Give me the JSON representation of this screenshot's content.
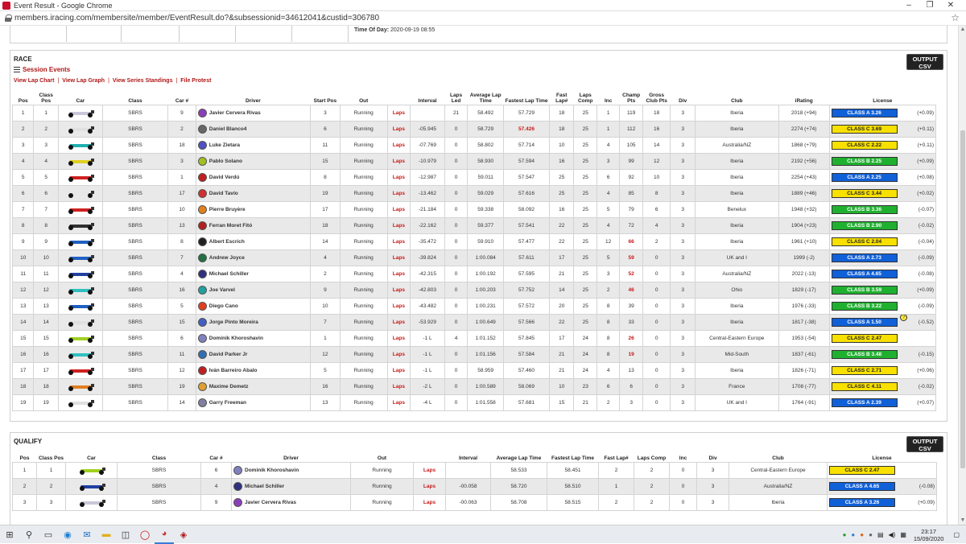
{
  "window": {
    "title": "Event Result - Google Chrome",
    "url": "members.iracing.com/membersite/member/EventResult.do?&subsessionid=34612041&custid=306780"
  },
  "top_panel": {
    "time_of_day_label": "Time Of Day:",
    "time_of_day_value": "2020-09-19 08:55"
  },
  "race": {
    "section_title": "RACE",
    "csv_button": [
      "OUTPUT",
      "CSV"
    ],
    "session_events": "Session Events",
    "links": [
      "View Lap Chart",
      "View Lap Graph",
      "View Series Standings",
      "File Protest"
    ],
    "headers": [
      "Pos",
      "Class Pos",
      "Car",
      "Class",
      "Car #",
      "Driver",
      "Start Pos",
      "Out",
      "",
      "Interval",
      "Laps Led",
      "Average Lap Time",
      "Fastest Lap Time",
      "Fast Lap#",
      "Laps Comp",
      "Inc",
      "Champ Pts",
      "Gross Club Pts",
      "Div",
      "Club",
      "iRating",
      "License"
    ],
    "rows": [
      {
        "pos": "1",
        "cpos": "1",
        "cls": "SBRS",
        "num": "9",
        "driver": "Javier Cervera Rivas",
        "start": "3",
        "out": "Running",
        "laps": "Laps",
        "interval": "",
        "led": "21",
        "avg": "58.492",
        "fast": "57.729",
        "flap": "18",
        "comp": "25",
        "inc": "1",
        "champ": "119",
        "gross": "18",
        "div": "3",
        "club": "Iberia",
        "ir": "2018 (+94)",
        "lic": "CLASS A 3.26",
        "lc": "A",
        "chg": "(+0.09)",
        "car": "#c8c8d8",
        "helm": "#8a3fb8",
        "champ_red": false,
        "fast_red": false
      },
      {
        "pos": "2",
        "cpos": "2",
        "cls": "SBRS",
        "num": "2",
        "driver": "Daniel Blanco4",
        "start": "6",
        "out": "Running",
        "laps": "Laps",
        "interval": "-05.945",
        "led": "0",
        "avg": "58.729",
        "fast": "57.426",
        "flap": "18",
        "comp": "25",
        "inc": "1",
        "champ": "112",
        "gross": "16",
        "div": "3",
        "club": "Iberia",
        "ir": "2274 (+74)",
        "lic": "CLASS C 3.69",
        "lc": "C",
        "chg": "(+0.11)",
        "car": "#e0e0e0",
        "helm": "#666666",
        "champ_red": false,
        "fast_red": true
      },
      {
        "pos": "3",
        "cpos": "3",
        "cls": "SBRS",
        "num": "18",
        "driver": "Luke Zietara",
        "start": "11",
        "out": "Running",
        "laps": "Laps",
        "interval": "-07.769",
        "led": "0",
        "avg": "58.802",
        "fast": "57.714",
        "flap": "10",
        "comp": "25",
        "inc": "4",
        "champ": "105",
        "gross": "14",
        "div": "3",
        "club": "Australia/NZ",
        "ir": "1868 (+79)",
        "lic": "CLASS C 2.22",
        "lc": "C",
        "chg": "(+0.11)",
        "car": "#20b0b0",
        "helm": "#5050c0",
        "champ_red": false,
        "fast_red": false
      },
      {
        "pos": "4",
        "cpos": "4",
        "cls": "SBRS",
        "num": "3",
        "driver": "Pablo Solano",
        "start": "15",
        "out": "Running",
        "laps": "Laps",
        "interval": "-10.979",
        "led": "0",
        "avg": "58.930",
        "fast": "57.594",
        "flap": "16",
        "comp": "25",
        "inc": "3",
        "champ": "99",
        "gross": "12",
        "div": "3",
        "club": "Iberia",
        "ir": "2192 (+56)",
        "lic": "CLASS B 2.25",
        "lc": "B",
        "chg": "(+0.09)",
        "car": "#e0d020",
        "helm": "#a0c020",
        "champ_red": false,
        "fast_red": false
      },
      {
        "pos": "5",
        "cpos": "5",
        "cls": "SBRS",
        "num": "1",
        "driver": "David Verdú",
        "start": "8",
        "out": "Running",
        "laps": "Laps",
        "interval": "-12.987",
        "led": "0",
        "avg": "59.011",
        "fast": "57.547",
        "flap": "25",
        "comp": "25",
        "inc": "6",
        "champ": "92",
        "gross": "10",
        "div": "3",
        "club": "Iberia",
        "ir": "2254 (+43)",
        "lic": "CLASS A 2.25",
        "lc": "A",
        "chg": "(+0.08)",
        "car": "#d02020",
        "helm": "#c02020",
        "champ_red": false,
        "fast_red": false
      },
      {
        "pos": "6",
        "cpos": "6",
        "cls": "SBRS",
        "num": "17",
        "driver": "David Tavío",
        "start": "19",
        "out": "Running",
        "laps": "Laps",
        "interval": "-13.462",
        "led": "0",
        "avg": "59.029",
        "fast": "57.616",
        "flap": "25",
        "comp": "25",
        "inc": "4",
        "champ": "85",
        "gross": "8",
        "div": "3",
        "club": "Iberia",
        "ir": "1889 (+46)",
        "lic": "CLASS C 3.44",
        "lc": "C",
        "chg": "(+0.02)",
        "car": "#e8e8e8",
        "helm": "#d03030",
        "champ_red": false,
        "fast_red": false
      },
      {
        "pos": "7",
        "cpos": "7",
        "cls": "SBRS",
        "num": "10",
        "driver": "Pierre Bruyère",
        "start": "17",
        "out": "Running",
        "laps": "Laps",
        "interval": "-21.184",
        "led": "0",
        "avg": "59.338",
        "fast": "58.092",
        "flap": "16",
        "comp": "25",
        "inc": "5",
        "champ": "79",
        "gross": "6",
        "div": "3",
        "club": "Benelux",
        "ir": "1948 (+32)",
        "lic": "CLASS B 3.36",
        "lc": "B",
        "chg": "(-0.07)",
        "car": "#d02020",
        "helm": "#e08020",
        "champ_red": false,
        "fast_red": false
      },
      {
        "pos": "8",
        "cpos": "8",
        "cls": "SBRS",
        "num": "13",
        "driver": "Ferran Moret Fitó",
        "start": "18",
        "out": "Running",
        "laps": "Laps",
        "interval": "-22.162",
        "led": "0",
        "avg": "59.377",
        "fast": "57.541",
        "flap": "22",
        "comp": "25",
        "inc": "4",
        "champ": "72",
        "gross": "4",
        "div": "3",
        "club": "Iberia",
        "ir": "1904 (+23)",
        "lic": "CLASS B 2.90",
        "lc": "B",
        "chg": "(-0.02)",
        "car": "#303030",
        "helm": "#b02020",
        "champ_red": false,
        "fast_red": false
      },
      {
        "pos": "9",
        "cpos": "9",
        "cls": "SBRS",
        "num": "8",
        "driver": "Albert Escrich",
        "start": "14",
        "out": "Running",
        "laps": "Laps",
        "interval": "-35.472",
        "led": "0",
        "avg": "59.910",
        "fast": "57.477",
        "flap": "22",
        "comp": "25",
        "inc": "12",
        "champ": "66",
        "gross": "2",
        "div": "3",
        "club": "Iberia",
        "ir": "1961 (+10)",
        "lic": "CLASS C 2.04",
        "lc": "C",
        "chg": "(-0.04)",
        "car": "#2060c0",
        "helm": "#202020",
        "champ_red": true,
        "fast_red": false
      },
      {
        "pos": "10",
        "cpos": "10",
        "cls": "SBRS",
        "num": "7",
        "driver": "Andrew Joyce",
        "start": "4",
        "out": "Running",
        "laps": "Laps",
        "interval": "-39.824",
        "led": "0",
        "avg": "1:00.084",
        "fast": "57.611",
        "flap": "17",
        "comp": "25",
        "inc": "5",
        "champ": "59",
        "gross": "0",
        "div": "3",
        "club": "UK and I",
        "ir": "1999 (-2)",
        "lic": "CLASS A 2.73",
        "lc": "A",
        "chg": "(-0.09)",
        "car": "#2060c0",
        "helm": "#207040",
        "champ_red": true,
        "fast_red": false
      },
      {
        "pos": "11",
        "cpos": "11",
        "cls": "SBRS",
        "num": "4",
        "driver": "Michael Schiller",
        "start": "2",
        "out": "Running",
        "laps": "Laps",
        "interval": "-42.315",
        "led": "0",
        "avg": "1:00.192",
        "fast": "57.595",
        "flap": "21",
        "comp": "25",
        "inc": "3",
        "champ": "52",
        "gross": "0",
        "div": "3",
        "club": "Australia/NZ",
        "ir": "2022 (-13)",
        "lic": "CLASS A 4.65",
        "lc": "A",
        "chg": "(-0.08)",
        "car": "#2040a0",
        "helm": "#303080",
        "champ_red": true,
        "fast_red": false
      },
      {
        "pos": "12",
        "cpos": "12",
        "cls": "SBRS",
        "num": "16",
        "driver": "Joe Varvel",
        "start": "9",
        "out": "Running",
        "laps": "Laps",
        "interval": "-42.803",
        "led": "0",
        "avg": "1:00.203",
        "fast": "57.752",
        "flap": "14",
        "comp": "25",
        "inc": "2",
        "champ": "46",
        "gross": "0",
        "div": "3",
        "club": "Ohio",
        "ir": "1829 (-17)",
        "lic": "CLASS B 3.59",
        "lc": "B",
        "chg": "(+0.09)",
        "car": "#30c0c0",
        "helm": "#20a0a0",
        "champ_red": true,
        "fast_red": false
      },
      {
        "pos": "13",
        "cpos": "13",
        "cls": "SBRS",
        "num": "5",
        "driver": "Diego Cano",
        "start": "10",
        "out": "Running",
        "laps": "Laps",
        "interval": "-43.482",
        "led": "0",
        "avg": "1:00.231",
        "fast": "57.572",
        "flap": "20",
        "comp": "25",
        "inc": "8",
        "champ": "39",
        "gross": "0",
        "div": "3",
        "club": "Iberia",
        "ir": "1976 (-33)",
        "lic": "CLASS B 3.22",
        "lc": "B",
        "chg": "(-0.09)",
        "car": "#2060c0",
        "helm": "#e04020",
        "champ_red": false,
        "fast_red": false
      },
      {
        "pos": "14",
        "cpos": "14",
        "cls": "SBRS",
        "num": "15",
        "driver": "Jorge Pinto Moreira",
        "start": "7",
        "out": "Running",
        "laps": "Laps",
        "interval": "-53.929",
        "led": "0",
        "avg": "1:00.649",
        "fast": "57.566",
        "flap": "22",
        "comp": "25",
        "inc": "8",
        "champ": "33",
        "gross": "0",
        "div": "3",
        "club": "Iberia",
        "ir": "1817 (-38)",
        "lic": "CLASS A 1.50",
        "lc": "A",
        "chg": "(-0.52)",
        "car": "#e0e0e0",
        "helm": "#4060c0",
        "champ_red": false,
        "fast_red": false,
        "qmark": true
      },
      {
        "pos": "15",
        "cpos": "15",
        "cls": "SBRS",
        "num": "6",
        "driver": "Dominik Khoroshavin",
        "start": "1",
        "out": "Running",
        "laps": "Laps",
        "interval": "-1 L",
        "led": "4",
        "avg": "1:01.152",
        "fast": "57.845",
        "flap": "17",
        "comp": "24",
        "inc": "8",
        "champ": "26",
        "gross": "0",
        "div": "3",
        "club": "Central-Eastern Europe",
        "ir": "1953 (-54)",
        "lic": "CLASS C 2.47",
        "lc": "C",
        "chg": "",
        "car": "#a0d020",
        "helm": "#8080c0",
        "champ_red": true,
        "fast_red": false
      },
      {
        "pos": "16",
        "cpos": "16",
        "cls": "SBRS",
        "num": "11",
        "driver": "David Parker Jr",
        "start": "12",
        "out": "Running",
        "laps": "Laps",
        "interval": "-1 L",
        "led": "0",
        "avg": "1:01.156",
        "fast": "57.584",
        "flap": "21",
        "comp": "24",
        "inc": "8",
        "champ": "19",
        "gross": "0",
        "div": "3",
        "club": "Mid-South",
        "ir": "1837 (-61)",
        "lic": "CLASS B 3.48",
        "lc": "B",
        "chg": "(-0.15)",
        "car": "#30c0c0",
        "helm": "#3070b0",
        "champ_red": true,
        "fast_red": false
      },
      {
        "pos": "17",
        "cpos": "17",
        "cls": "SBRS",
        "num": "12",
        "driver": "Iván Barreiro Abalo",
        "start": "5",
        "out": "Running",
        "laps": "Laps",
        "interval": "-1 L",
        "led": "0",
        "avg": "58.959",
        "fast": "57.460",
        "flap": "21",
        "comp": "24",
        "inc": "4",
        "champ": "13",
        "gross": "0",
        "div": "3",
        "club": "Iberia",
        "ir": "1826 (-71)",
        "lic": "CLASS C 2.71",
        "lc": "C",
        "chg": "(+0.06)",
        "car": "#d02020",
        "helm": "#c02020",
        "champ_red": false,
        "fast_red": false
      },
      {
        "pos": "18",
        "cpos": "18",
        "cls": "SBRS",
        "num": "19",
        "driver": "Maxime Demetz",
        "start": "16",
        "out": "Running",
        "laps": "Laps",
        "interval": "-2 L",
        "led": "0",
        "avg": "1:00.589",
        "fast": "58.069",
        "flap": "10",
        "comp": "23",
        "inc": "6",
        "champ": "6",
        "gross": "0",
        "div": "3",
        "club": "France",
        "ir": "1708 (-77)",
        "lic": "CLASS C 4.11",
        "lc": "C",
        "chg": "(-0.02)",
        "car": "#e08020",
        "helm": "#e0a030",
        "champ_red": false,
        "fast_red": false
      },
      {
        "pos": "19",
        "cpos": "19",
        "cls": "SBRS",
        "num": "14",
        "driver": "Garry Freeman",
        "start": "13",
        "out": "Running",
        "laps": "Laps",
        "interval": "-4 L",
        "led": "0",
        "avg": "1:01.558",
        "fast": "57.681",
        "flap": "15",
        "comp": "21",
        "inc": "2",
        "champ": "3",
        "gross": "0",
        "div": "3",
        "club": "UK and I",
        "ir": "1764 (-91)",
        "lic": "CLASS A 2.39",
        "lc": "A",
        "chg": "(+0.07)",
        "car": "#e0e0e0",
        "helm": "#8080a0",
        "champ_red": false,
        "fast_red": false
      }
    ]
  },
  "qualify": {
    "section_title": "QUALIFY",
    "csv_button": [
      "OUTPUT",
      "CSV"
    ],
    "headers": [
      "Pos",
      "Class Pos",
      "Car",
      "Class",
      "Car #",
      "Driver",
      "Out",
      "",
      "Interval",
      "Average Lap Time",
      "Fastest Lap Time",
      "Fast Lap#",
      "Laps Comp",
      "Inc",
      "Div",
      "Club",
      "License"
    ],
    "rows": [
      {
        "pos": "1",
        "cpos": "1",
        "cls": "SBRS",
        "num": "6",
        "driver": "Dominik Khoroshavin",
        "out": "Running",
        "laps": "Laps",
        "interval": "",
        "avg": "58.533",
        "fast": "58.451",
        "flap": "2",
        "comp": "2",
        "inc": "0",
        "div": "3",
        "club": "Central-Eastern Europe",
        "lic": "CLASS C 2.47",
        "lc": "C",
        "chg": "",
        "car": "#a0d020",
        "helm": "#8080c0"
      },
      {
        "pos": "2",
        "cpos": "2",
        "cls": "SBRS",
        "num": "4",
        "driver": "Michael Schiller",
        "out": "Running",
        "laps": "Laps",
        "interval": "-00.058",
        "avg": "58.720",
        "fast": "58.510",
        "flap": "1",
        "comp": "2",
        "inc": "0",
        "div": "3",
        "club": "Australia/NZ",
        "lic": "CLASS A 4.65",
        "lc": "A",
        "chg": "(-0.08)",
        "car": "#2040a0",
        "helm": "#303080"
      },
      {
        "pos": "3",
        "cpos": "3",
        "cls": "SBRS",
        "num": "9",
        "driver": "Javier Cervera Rivas",
        "out": "Running",
        "laps": "Laps",
        "interval": "-00.063",
        "avg": "58.708",
        "fast": "58.515",
        "flap": "2",
        "comp": "2",
        "inc": "0",
        "div": "3",
        "club": "Iberia",
        "lic": "CLASS A 3.26",
        "lc": "A",
        "chg": "(+0.09)",
        "car": "#c8c8d8",
        "helm": "#8a3fb8"
      }
    ]
  },
  "taskbar": {
    "time": "23:17",
    "date": "15/09/2020"
  }
}
